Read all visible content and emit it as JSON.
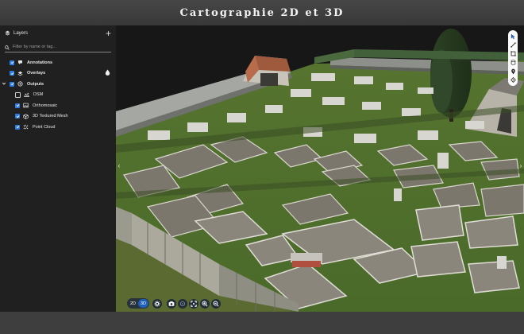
{
  "banner": {
    "title": "Cartographie 2D et 3D"
  },
  "sidebar": {
    "title": "Layers",
    "add_icon": "plus-icon",
    "search": {
      "placeholder": "Filter by name or tag...",
      "value": ""
    },
    "layers": [
      {
        "label": "Annotations",
        "checked": true,
        "expanded": false,
        "icon": "annotation-icon"
      },
      {
        "label": "Overlays",
        "checked": true,
        "expanded": false,
        "icon": "overlay-icon"
      },
      {
        "label": "Outputs",
        "checked": true,
        "expanded": true,
        "icon": "output-icon"
      }
    ],
    "outputs": [
      {
        "label": "DSM",
        "checked": false,
        "icon": "dsm-icon"
      },
      {
        "label": "Orthomosaic",
        "checked": true,
        "icon": "orthomosaic-icon"
      },
      {
        "label": "3D Textured Mesh",
        "checked": true,
        "icon": "mesh-icon"
      },
      {
        "label": "Point Cloud",
        "checked": true,
        "icon": "point-cloud-icon"
      }
    ]
  },
  "viewport": {
    "view_modes": [
      "2D",
      "3D"
    ],
    "active_mode": "3D",
    "right_tools": [
      "select-icon",
      "line-icon",
      "area-icon",
      "volume-icon",
      "marker-icon",
      "location-icon"
    ],
    "bottom_tools": [
      "settings-icon",
      "camera-icon",
      "target-icon",
      "fit-icon",
      "zoom-in-icon",
      "zoom-out-icon"
    ]
  }
}
